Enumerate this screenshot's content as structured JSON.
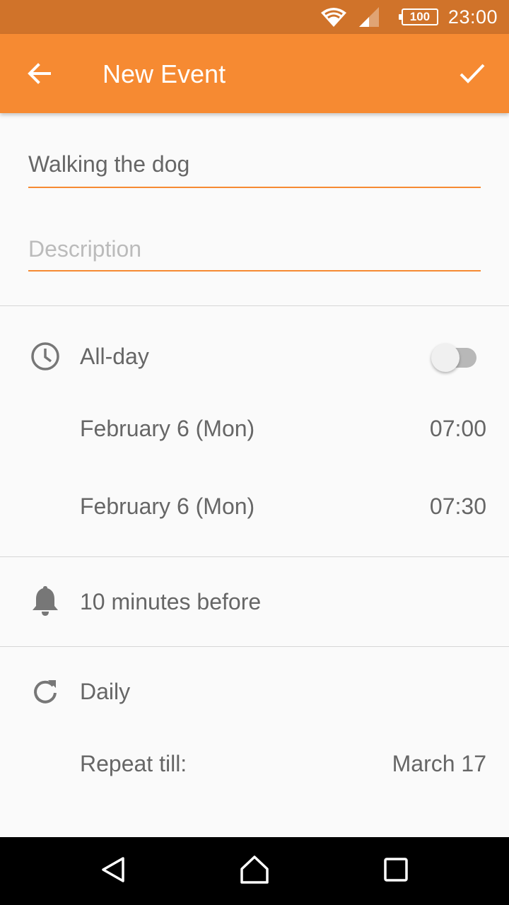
{
  "status_bar": {
    "battery": "100",
    "time": "23:00"
  },
  "app_bar": {
    "title": "New Event"
  },
  "form": {
    "title_value": "Walking the dog",
    "description_placeholder": "Description"
  },
  "time_section": {
    "all_day_label": "All-day",
    "all_day_enabled": false,
    "start_date": "February 6 (Mon)",
    "start_time": "07:00",
    "end_date": "February 6 (Mon)",
    "end_time": "07:30"
  },
  "reminder": {
    "label": "10 minutes before"
  },
  "repeat": {
    "frequency": "Daily",
    "until_label": "Repeat till:",
    "until_value": "March 17"
  },
  "colors": {
    "accent": "#f68a32",
    "status_bar": "#d0732a",
    "text": "#666666"
  }
}
